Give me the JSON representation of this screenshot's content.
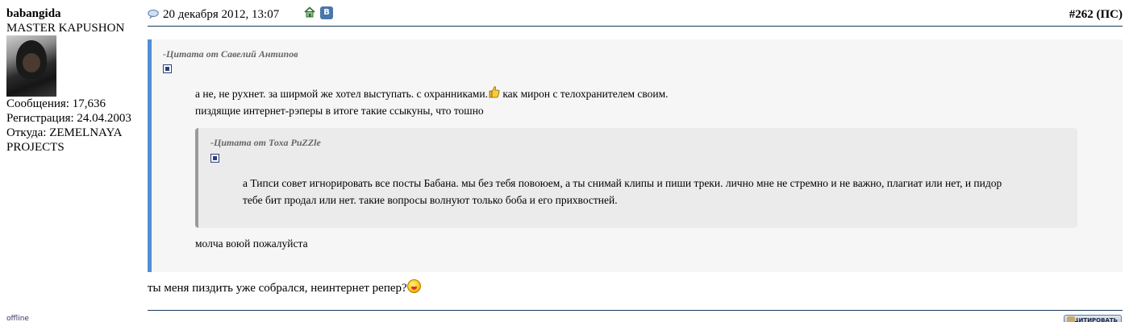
{
  "user": {
    "name": "babangida",
    "rank": "MASTER KAPUSHON",
    "posts_label": "Сообщения: 17,636",
    "registered_label": "Регистрация: 24.04.2003",
    "location_label": "Откуда: ZEMELNAYA PROJECTS",
    "status": "offline"
  },
  "header": {
    "date": "20 декабря 2012, 13:07",
    "post_number": "#262",
    "post_tag": "(ПС)",
    "icons": [
      "comment-icon",
      "home-icon",
      "vk-icon"
    ],
    "vk_letter": "В"
  },
  "quote_outer": {
    "title": "-Цитата от Савелий Антипов",
    "line1_before": "а не, не рухнет. за ширмой же хотел выступать. с охранниками.",
    "line1_after": " как мирон с телохранителем своим.",
    "line2": "пиздящие интернет-рэперы в итоге такие ссыкуны, что тошно",
    "after_inner": "молча воюй пожалуйста"
  },
  "quote_inner": {
    "title": "-Цитата от Тоха PuZZle",
    "line1": "а Типси совет игнорировать все посты Бабана. мы без тебя повоюем, а ты снимай клипы и пиши треки. лично мне не стремно и не важно, плагиат или нет, и пидор",
    "line2": "тебе бит продал или нет. такие вопросы волнуют только боба и его прихвостней."
  },
  "post_body": {
    "text": "ты меня пиздить уже собрался, неинтернет репер?"
  },
  "footer": {
    "quote_button_label": "ЦИТИРОВАТЬ"
  },
  "colors": {
    "quote_border": "#4f8fd6",
    "quote_bg": "#f6f6f6",
    "inner_quote_bg": "#ebebeb",
    "rule": "#1a3a5a"
  }
}
